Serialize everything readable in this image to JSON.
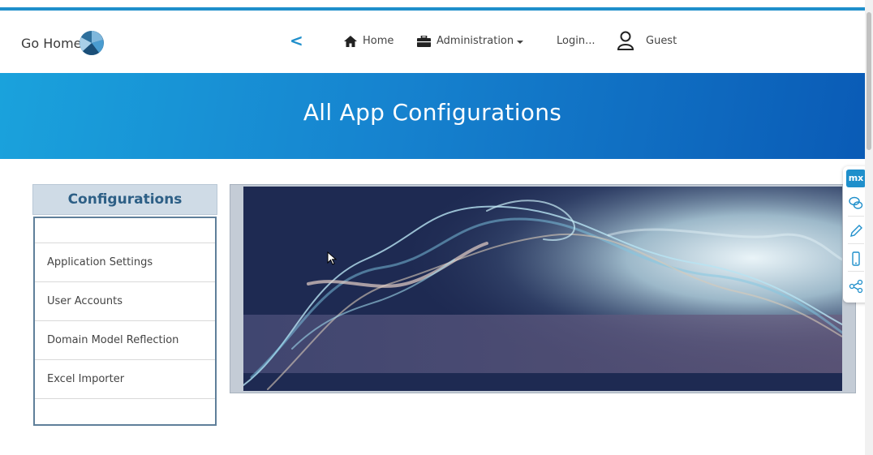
{
  "navbar": {
    "brand_label": "Go Home",
    "back_label": "<",
    "home_label": "Home",
    "administration_label": "Administration",
    "login_label": "Login...",
    "user_label": "Guest"
  },
  "hero": {
    "title": "All App Configurations"
  },
  "sidebar": {
    "header": "Configurations",
    "items": [
      {
        "label": ""
      },
      {
        "label": "Application Settings"
      },
      {
        "label": "User Accounts"
      },
      {
        "label": "Domain Model Reflection"
      },
      {
        "label": "Excel Importer"
      }
    ]
  },
  "mx_toolbar": {
    "logo_label": "mx",
    "tools": [
      "feedback-icon",
      "edit-icon",
      "mobile-icon",
      "share-icon"
    ]
  },
  "colors": {
    "accent": "#1f8fcb",
    "hero_start": "#1aa2dc",
    "hero_end": "#0a5bb6",
    "panel_header_bg": "#cfdbe6",
    "panel_header_text": "#2d5f86",
    "banner_bg": "#1e2a52"
  }
}
